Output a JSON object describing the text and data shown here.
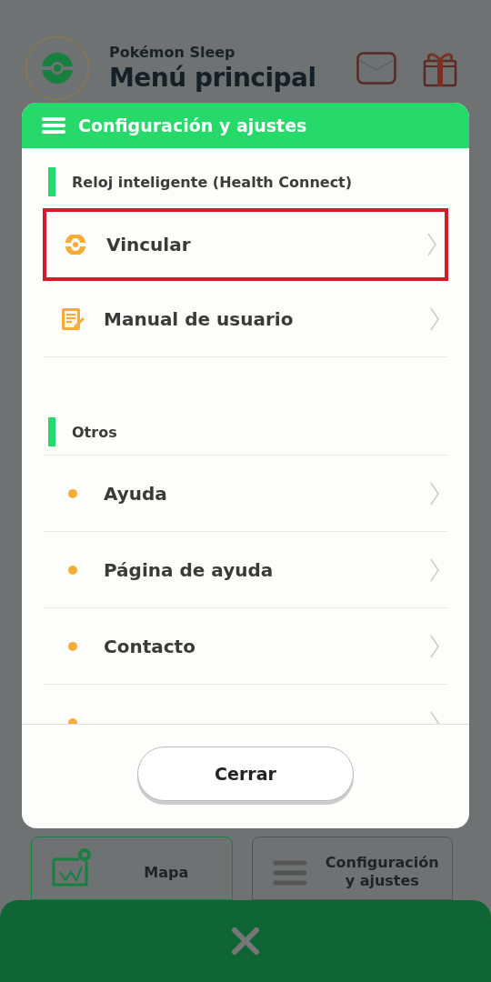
{
  "header": {
    "app_name": "Pokémon Sleep",
    "title": "Menú principal"
  },
  "dialog": {
    "title": "Configuración y ajustes",
    "sections": [
      {
        "title": "Reloj inteligente (Health Connect)",
        "items": [
          {
            "label": "Vincular",
            "kind": "link",
            "highlighted": true
          },
          {
            "label": "Manual de usuario",
            "kind": "manual",
            "highlighted": false
          }
        ]
      },
      {
        "title": "Otros",
        "items": [
          {
            "label": "Ayuda",
            "kind": "dot",
            "highlighted": false
          },
          {
            "label": "Página de ayuda",
            "kind": "dot",
            "highlighted": false
          },
          {
            "label": "Contacto",
            "kind": "dot",
            "highlighted": false
          },
          {
            "kind": "dot",
            "highlighted": false
          }
        ]
      }
    ],
    "close_button": "Cerrar"
  },
  "tiles": [
    {
      "label": "Mapa",
      "kind": "map",
      "selected": true
    },
    {
      "label": "Configuración\ny ajustes",
      "kind": "menu",
      "selected": false
    }
  ]
}
